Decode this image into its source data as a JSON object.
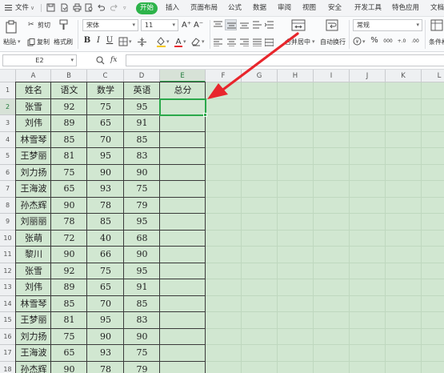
{
  "menu": {
    "file": "文件",
    "tabs": [
      "开始",
      "插入",
      "页面布局",
      "公式",
      "数据",
      "审阅",
      "视图",
      "安全",
      "开发工具",
      "特色应用",
      "文档助手"
    ],
    "active_tab": "开始"
  },
  "ribbon": {
    "paste": "粘贴",
    "cut": "剪切",
    "copy": "复制",
    "format_painter": "格式刷",
    "font_name": "宋体",
    "font_size": "11",
    "merge_center": "合并居中",
    "wrap_text": "自动换行",
    "number_format": "常规",
    "percent_glyph": "%",
    "thousands_glyph": "000",
    "decimal_inc": "+.0",
    "decimal_dec": ".00",
    "conditional_format": "条件格",
    "bold": "B",
    "italic": "I",
    "underline": "U",
    "increase_font": "A⁺",
    "decrease_font": "A⁻"
  },
  "formula_bar": {
    "name_box": "E2",
    "fx": "fx",
    "value": ""
  },
  "sheet": {
    "columns": [
      "A",
      "B",
      "C",
      "D",
      "E",
      "F",
      "G",
      "H",
      "I",
      "J",
      "K",
      "L"
    ],
    "active_column": "E",
    "row_numbers": [
      "1",
      "2",
      "3",
      "4",
      "5",
      "6",
      "7",
      "8",
      "9",
      "10",
      "11",
      "12",
      "13",
      "14",
      "15",
      "16",
      "17",
      "18"
    ],
    "active_row": "2",
    "headers": [
      "姓名",
      "语文",
      "数学",
      "英语",
      "总分"
    ],
    "rows": [
      [
        "张雪",
        "92",
        "75",
        "95"
      ],
      [
        "刘伟",
        "89",
        "65",
        "91"
      ],
      [
        "林雪琴",
        "85",
        "70",
        "85"
      ],
      [
        "王梦丽",
        "81",
        "95",
        "83"
      ],
      [
        "刘力扬",
        "75",
        "90",
        "90"
      ],
      [
        "王海波",
        "65",
        "93",
        "75"
      ],
      [
        "孙杰辉",
        "90",
        "78",
        "79"
      ],
      [
        "刘丽丽",
        "78",
        "85",
        "95"
      ],
      [
        "张萌",
        "72",
        "40",
        "68"
      ],
      [
        "黎川",
        "90",
        "66",
        "90"
      ],
      [
        "张雪",
        "92",
        "75",
        "95"
      ],
      [
        "刘伟",
        "89",
        "65",
        "91"
      ],
      [
        "林雪琴",
        "85",
        "70",
        "85"
      ],
      [
        "王梦丽",
        "81",
        "95",
        "83"
      ],
      [
        "刘力扬",
        "75",
        "90",
        "90"
      ],
      [
        "王海波",
        "65",
        "93",
        "75"
      ],
      [
        "孙杰辉",
        "90",
        "78",
        "79"
      ]
    ],
    "selected_cell": "E2"
  },
  "colors": {
    "accent_green": "#2db34a",
    "sheet_background": "#d1e7d1",
    "arrow_red": "#e8262c"
  }
}
